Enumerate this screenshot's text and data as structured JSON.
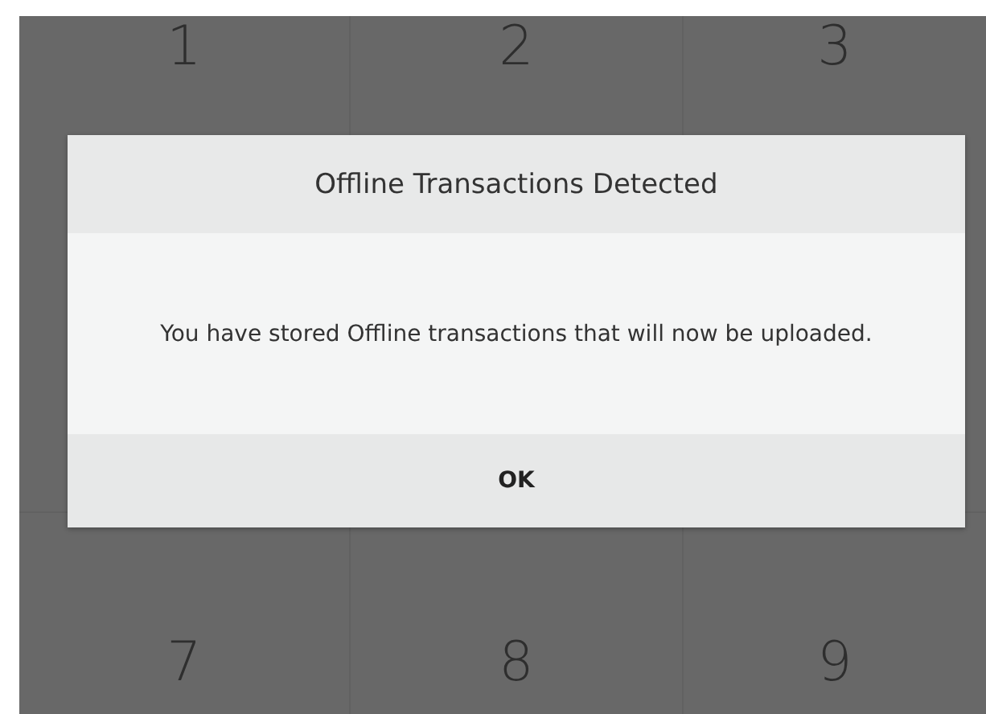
{
  "keypad": {
    "keys": [
      {
        "label": "1"
      },
      {
        "label": "2"
      },
      {
        "label": "3"
      },
      {
        "label": "7"
      },
      {
        "label": "8"
      },
      {
        "label": "9"
      }
    ]
  },
  "dialog": {
    "title": "Offline Transactions Detected",
    "message": "You have stored Offline transactions that will now be uploaded.",
    "buttons": [
      "OK"
    ]
  }
}
